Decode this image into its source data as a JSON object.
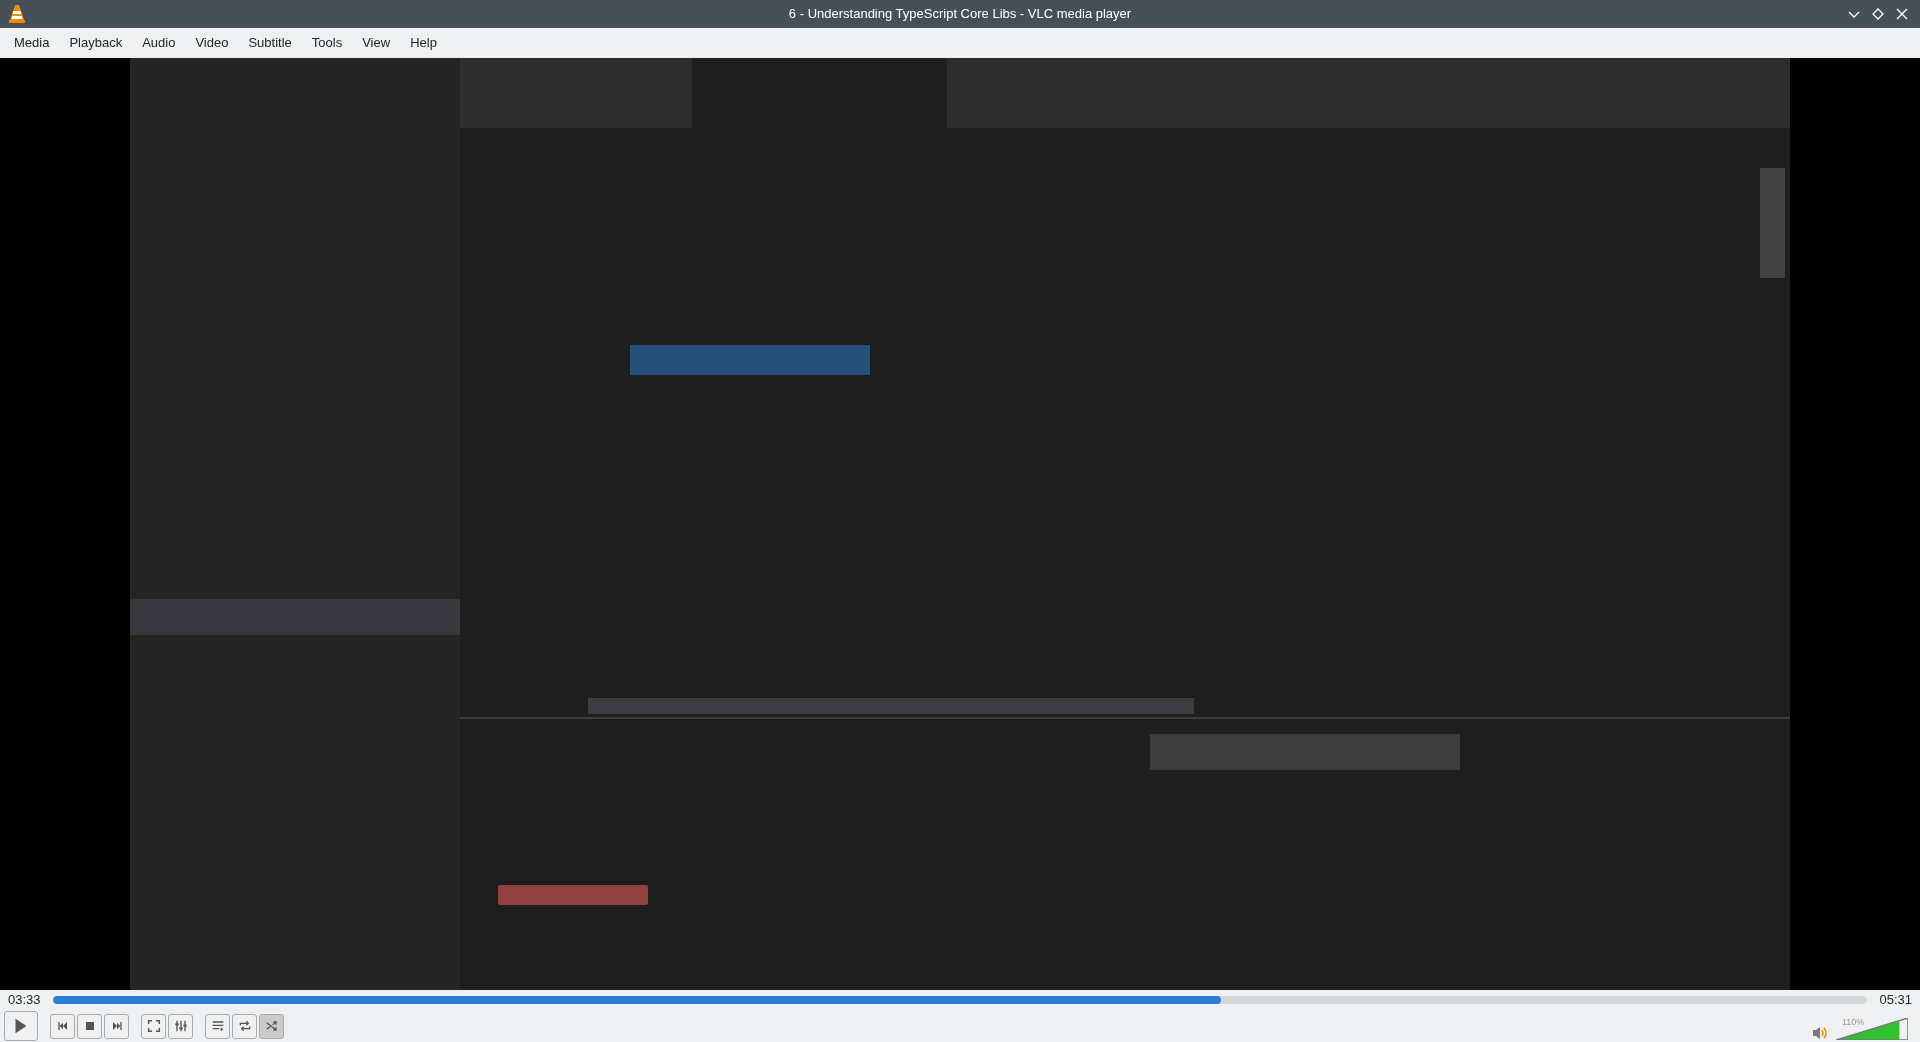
{
  "window": {
    "title": "6 - Understanding TypeScript Core Libs - VLC media player"
  },
  "menu": [
    {
      "label": "Media"
    },
    {
      "label": "Playback"
    },
    {
      "label": "Audio"
    },
    {
      "label": "Video"
    },
    {
      "label": "Subtitle"
    },
    {
      "label": "Tools"
    },
    {
      "label": "View"
    },
    {
      "label": "Help"
    }
  ],
  "seek": {
    "elapsed": "03:33",
    "total": "05:31",
    "level": 0.644
  },
  "controls": [
    {
      "kind": "play",
      "on": false
    },
    {
      "kind": "prev",
      "on": false
    },
    {
      "kind": "stop",
      "on": false
    },
    {
      "kind": "next",
      "on": false
    },
    {
      "kind": "fullscreen",
      "on": false
    },
    {
      "kind": "equalizer",
      "on": false
    },
    {
      "kind": "playlist",
      "on": false
    },
    {
      "kind": "loop",
      "on": false
    },
    {
      "kind": "shuffle",
      "on": true
    }
  ],
  "volume": {
    "reading": "110%",
    "level": 0.88
  }
}
